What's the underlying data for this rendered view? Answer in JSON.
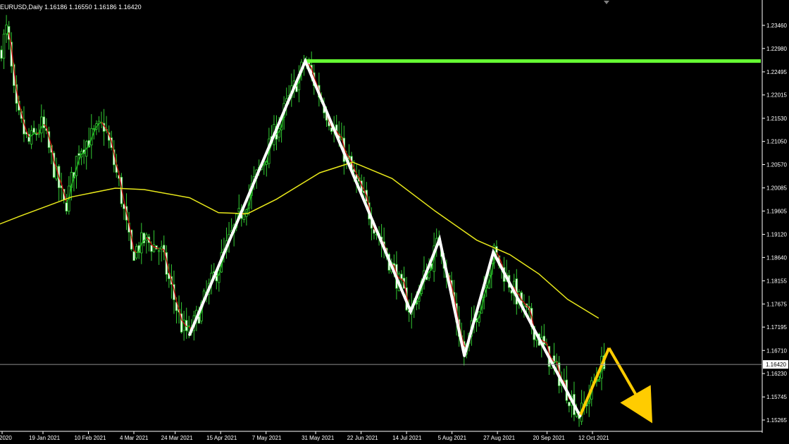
{
  "title": "EURUSD,Daily  1.16186 1.16550 1.16186 1.16420",
  "chart_data": {
    "type": "candlestick",
    "instrument": "EURUSD",
    "timeframe": "Daily",
    "ohlc": {
      "open": 1.16186,
      "high": 1.1655,
      "low": 1.16186,
      "close": 1.1642
    },
    "current_price_label": "1.16420",
    "y_ticks": [
      "1.23460",
      "1.22980",
      "1.22495",
      "1.22015",
      "1.21530",
      "1.21050",
      "1.20570",
      "1.20085",
      "1.19605",
      "1.19120",
      "1.18640",
      "1.18155",
      "1.17675",
      "1.17195",
      "1.16710",
      "1.16230",
      "1.15745",
      "1.15265"
    ],
    "x_ticks": [
      "2020",
      "19 Jan 2021",
      "10 Feb 2021",
      "4 Mar 2021",
      "24 Mar 2021",
      "15 Apr 2021",
      "7 May 2021",
      "31 May 2021",
      "22 Jun 2021",
      "14 Jul 2021",
      "5 Aug 2021",
      "27 Aug 2021",
      "20 Sep 2021",
      "12 Oct 2021"
    ],
    "resistance_level": 1.2272,
    "pattern_points": [
      {
        "date": "2021-03-31",
        "price": 1.1704
      },
      {
        "date": "2021-05-26",
        "price": 1.2272
      },
      {
        "date": "2021-07-16",
        "price": 1.1752
      },
      {
        "date": "2021-07-30",
        "price": 1.1902
      },
      {
        "date": "2021-08-11",
        "price": 1.166
      },
      {
        "date": "2021-08-25",
        "price": 1.1875
      },
      {
        "date": "2021-10-06",
        "price": 1.1535
      },
      {
        "date": "2021-10-20",
        "price": 1.1676
      }
    ],
    "projection": {
      "from": {
        "date": "2021-10-20",
        "price": 1.1676
      },
      "to": {
        "date": "2021-11-10",
        "price": 1.152
      }
    },
    "moving_average_long": [
      {
        "date": "2020-12-04",
        "price": 1.1875
      },
      {
        "date": "2020-12-18",
        "price": 1.1915
      },
      {
        "date": "2021-01-08",
        "price": 1.195
      },
      {
        "date": "2021-02-02",
        "price": 1.199
      },
      {
        "date": "2021-02-23",
        "price": 1.2008
      },
      {
        "date": "2021-03-09",
        "price": 1.2005
      },
      {
        "date": "2021-03-31",
        "price": 1.1988
      },
      {
        "date": "2021-04-14",
        "price": 1.1957
      },
      {
        "date": "2021-04-28",
        "price": 1.1955
      },
      {
        "date": "2021-05-12",
        "price": 1.1985
      },
      {
        "date": "2021-06-02",
        "price": 1.204
      },
      {
        "date": "2021-06-18",
        "price": 1.2062
      },
      {
        "date": "2021-07-07",
        "price": 1.2028
      },
      {
        "date": "2021-07-28",
        "price": 1.196
      },
      {
        "date": "2021-08-17",
        "price": 1.19
      },
      {
        "date": "2021-09-02",
        "price": 1.187
      },
      {
        "date": "2021-09-16",
        "price": 1.183
      },
      {
        "date": "2021-09-30",
        "price": 1.1777
      },
      {
        "date": "2021-10-15",
        "price": 1.1738
      }
    ],
    "colors": {
      "background": "#000000",
      "axis": "#ffffff",
      "grid_text": "#ffffff",
      "resistance": "#66ff33",
      "pattern": "#ffffff",
      "projection": "#ffcc00",
      "ma_long": "#e8e81a",
      "bull_candle": "#33cc33",
      "ma_fast_up": "#22bb22",
      "ma_fast_down": "#cc1111"
    },
    "grid": false,
    "legend": "none"
  }
}
